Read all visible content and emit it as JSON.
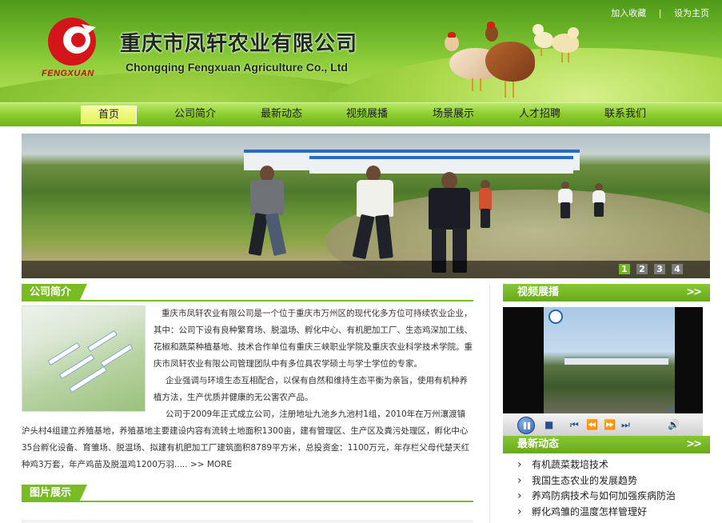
{
  "header": {
    "logo_text": "FENGXUAN",
    "title_cn": "重庆市凤轩农业有限公司",
    "title_en": "Chongqing Fengxuan Agriculture Co., Ltd",
    "top_links": [
      "加入收藏",
      "|",
      "设为主页"
    ]
  },
  "nav": {
    "items": [
      "首页",
      "公司简介",
      "最新动态",
      "视频展播",
      "场景展示",
      "人才招聘",
      "联系我们"
    ],
    "active_index": 0
  },
  "banner": {
    "pager": [
      "1",
      "2",
      "3",
      "4"
    ],
    "active_page": "1"
  },
  "about": {
    "heading": "公司简介",
    "paragraphs": [
      "重庆市凤轩农业有限公司是一个位于重庆市万州区的现代化多方位可持续农业企业，其中：公司下设有良种繁育场、脱温场、孵化中心、有机肥加工厂、生态鸡深加工线、花椒和蔬菜种植基地、技术合作单位有重庆三峡职业学院及重庆农业科学技术学院。重庆市凤轩农业有限公司管理团队中有多位具农学硕士与学士学位的专家。",
      "企业强调与环境生态互相配合，以保有自然和维持生态平衡为亲旨，使用有机种养植方法，生产优质并健康的无公害农产品。",
      "公司于2009年正式成立公司，注册地址九池乡九池村1组，2010年在万州瀼渡镇沪头村4组建立养殖基地，养殖基地主要建设内容有流转土地面积1300亩，建有管理区、生产区及粪污处理区，孵化中心35台孵化设备、育雏场、脱温场、拟建有机肥加工厂建筑面积8789平方米，总投资金：1100万元，年存栏父母代楚天红种鸡3万套，年产鸡苗及脱温鸡1200万羽....."
    ],
    "more_label": ">> MORE"
  },
  "gallery": {
    "heading": "图片展示"
  },
  "video": {
    "heading": "视频展播",
    "more": ">>"
  },
  "news": {
    "heading": "最新动态",
    "more": ">>",
    "items": [
      "有机蔬菜栽培技术",
      "我国生态农业的发展趋势",
      "养鸡防病技术与如何加强疾病防治",
      "孵化鸡雏的温度怎样管理好"
    ]
  },
  "colors": {
    "accent_green": "#79bb22",
    "logo_red": "#c40f12",
    "pager_active": "#74b722"
  }
}
